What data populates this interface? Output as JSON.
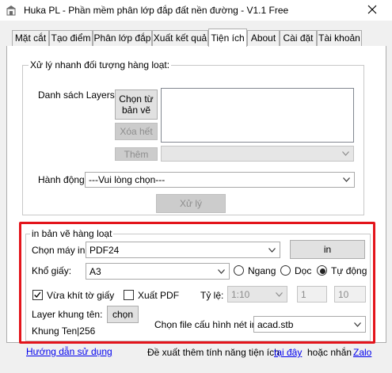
{
  "window": {
    "title": "Huka PL - Phần mềm phân lớp đắp đất nền đường - V1.1 Free",
    "close_glyph": "✕"
  },
  "tabs": [
    {
      "label": "Mặt cắt"
    },
    {
      "label": "Tạo điểm"
    },
    {
      "label": "Phân lớp đắp"
    },
    {
      "label": "Xuất kết quả"
    },
    {
      "label": "Tiện ích"
    },
    {
      "label": "About"
    },
    {
      "label": "Cài đặt"
    },
    {
      "label": "Tài khoản"
    }
  ],
  "quick_group": {
    "title": "Xử lý nhanh đối tượng hàng loạt:",
    "layers_label": "Danh sách Layers:",
    "pick_drawing_button": "Chọn từ bản vẽ",
    "clear_all_button": "Xóa hết",
    "add_button": "Thêm",
    "layer_combo_value": "",
    "action_label": "Hành động:",
    "action_value": "---Vui lòng chọn---",
    "process_button": "Xử lý"
  },
  "print_group": {
    "title": "in bản vẽ hàng loạt",
    "printer_label": "Chọn máy in:",
    "printer_value": "PDF24",
    "print_button": "in",
    "paper_label": "Khổ giấy:",
    "paper_value": "A3",
    "orientation": {
      "landscape": "Ngang",
      "portrait": "Dọc",
      "auto": "Tự động",
      "selected": "auto"
    },
    "fit_paper_label": "Vừa khít tờ giấy",
    "fit_paper_checked": true,
    "export_pdf_label": "Xuất PDF",
    "export_pdf_checked": false,
    "scale_label": "Tỷ lệ:",
    "scale_value": "1:10",
    "scale_num": "1",
    "scale_den": "10",
    "frame_layer_label": "Layer khung tên:",
    "frame_pick_button": "chọn",
    "frame_layer_value": "Khung Ten|256",
    "plotstyle_label": "Chọn file cấu hình nét in",
    "plotstyle_value": "acad.stb"
  },
  "footer": {
    "guide_link": "Hướng dẫn sử dụng",
    "suggest_text": "Đề xuất thêm tính năng tiện ích",
    "here_link": "tại đây",
    "or_text": "hoặc nhắn",
    "zalo_link": "Zalo"
  },
  "colors": {
    "highlight_frame": "#e3141b",
    "link": "#0000ee"
  }
}
